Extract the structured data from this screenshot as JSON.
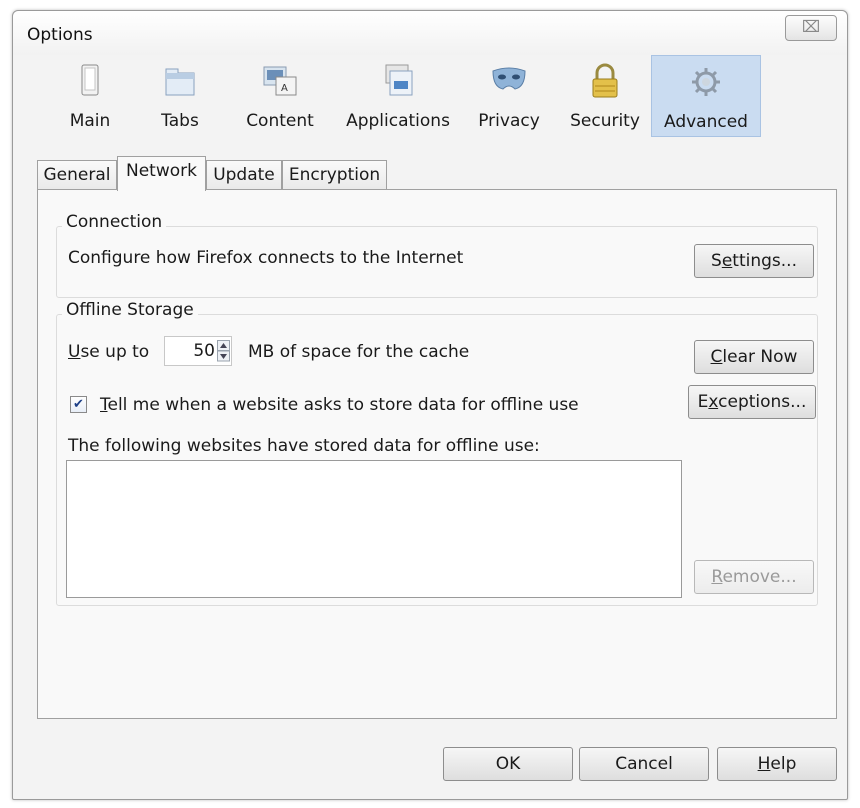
{
  "window": {
    "title": "Options",
    "close_label": "⌧"
  },
  "toolbar": {
    "items": [
      {
        "label": "Main",
        "icon": "main-icon"
      },
      {
        "label": "Tabs",
        "icon": "tabs-icon"
      },
      {
        "label": "Content",
        "icon": "content-icon"
      },
      {
        "label": "Applications",
        "icon": "applications-icon"
      },
      {
        "label": "Privacy",
        "icon": "privacy-mask-icon"
      },
      {
        "label": "Security",
        "icon": "padlock-icon"
      },
      {
        "label": "Advanced",
        "icon": "gear-icon",
        "selected": true
      }
    ]
  },
  "tabs": [
    {
      "label": "General"
    },
    {
      "label": "Network",
      "selected": true
    },
    {
      "label": "Update"
    },
    {
      "label": "Encryption"
    }
  ],
  "connection": {
    "label": "Connection",
    "description": "Configure how Firefox connects to the Internet",
    "settings_button": {
      "pre": "S",
      "accel": "e",
      "post": "ttings..."
    }
  },
  "offline": {
    "label": "Offline Storage",
    "use_up_to": {
      "accel": "U",
      "post": "se up to"
    },
    "cache_value": "50",
    "cache_suffix": "MB of space for the cache",
    "clear_button": {
      "accel": "C",
      "post": "lear Now"
    },
    "tell_me": {
      "checked": true,
      "check_mark": "✔",
      "accel": "T",
      "post": "ell me when a website asks to store data for offline use"
    },
    "exceptions_button": {
      "pre": "E",
      "accel": "x",
      "post": "ceptions..."
    },
    "following_text": "The following websites have stored data for offline use:",
    "remove_button": {
      "accel": "R",
      "post": "emove..."
    }
  },
  "footer": {
    "ok_label": "OK",
    "cancel_label": "Cancel",
    "help_button": {
      "accel": "H",
      "post": "elp"
    }
  },
  "colors": {
    "selected_toolbar_bg": "#cadcf1",
    "checkmark": "#1c3f87"
  }
}
